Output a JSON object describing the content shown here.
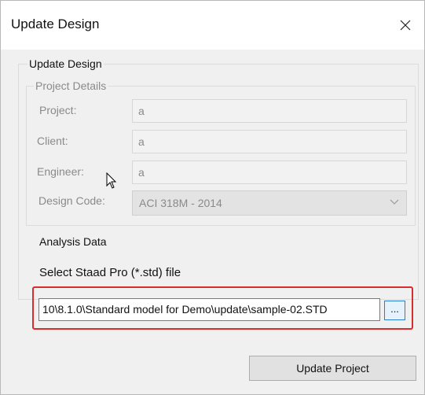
{
  "window": {
    "title": "Update Design"
  },
  "main_group": {
    "label": "Update Design"
  },
  "project_details": {
    "label": "Project Details",
    "project_label": "Project:",
    "project_value": "a",
    "client_label": "Client:",
    "client_value": "a",
    "engineer_label": "Engineer:",
    "engineer_value": "a",
    "design_code_label": "Design Code:",
    "design_code_value": "ACI 318M - 2014"
  },
  "analysis_data": {
    "label": "Analysis Data",
    "select_label": "Select Staad Pro (*.std) file",
    "file_path": "10\\8.1.0\\Standard model for Demo\\update\\sample-02.STD",
    "browse_label": "..."
  },
  "actions": {
    "update_label": "Update Project"
  },
  "icons": {
    "close": "close-icon",
    "dropdown": "chevron-down-icon",
    "cursor": "mouse-pointer-icon"
  },
  "colors": {
    "highlight": "#d62d2d",
    "focus_border": "#2a7bd4"
  }
}
